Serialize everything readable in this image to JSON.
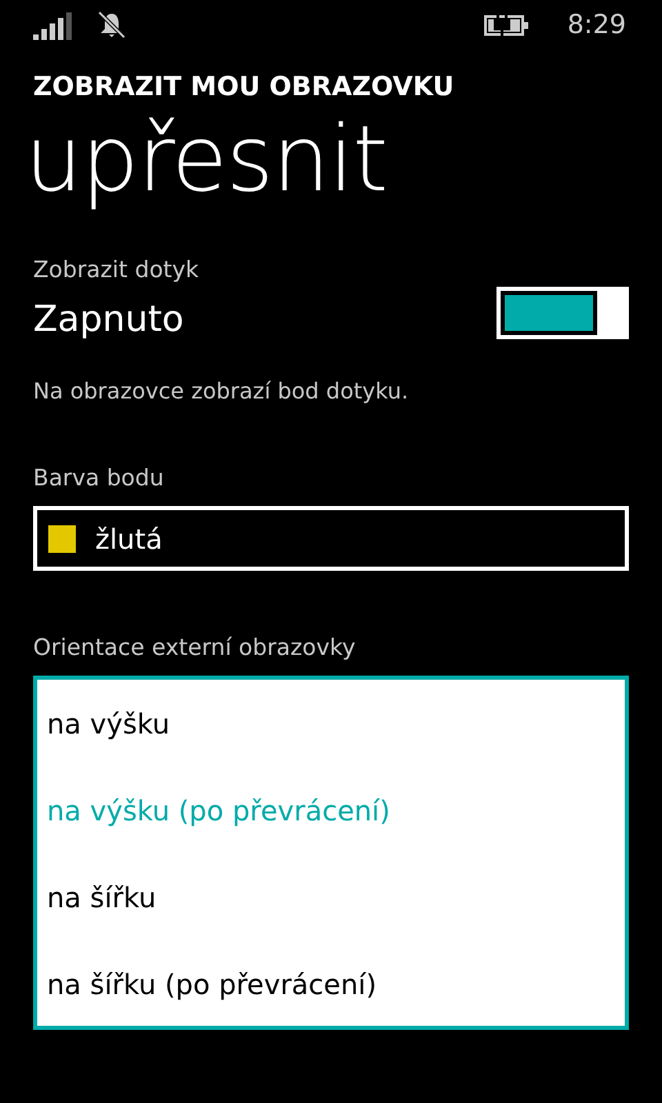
{
  "status_bar": {
    "time": "8:29"
  },
  "header": {
    "app_title": "ZOBRAZIT MOU OBRAZOVKU",
    "page_title": "upřesnit"
  },
  "touch_toggle": {
    "label": "Zobrazit dotyk",
    "value": "Zapnuto",
    "on": true
  },
  "description": "Na obrazovce zobrazí bod dotyku.",
  "point_color": {
    "label": "Barva bodu",
    "value": "žlutá",
    "color": "#e3c800"
  },
  "orientation": {
    "label": "Orientace externí obrazovky",
    "options": [
      {
        "label": "na výšku",
        "selected": false
      },
      {
        "label": "na výšku (po převrácení)",
        "selected": true
      },
      {
        "label": "na šířku",
        "selected": false
      },
      {
        "label": "na šířku (po převrácení)",
        "selected": false
      }
    ]
  }
}
